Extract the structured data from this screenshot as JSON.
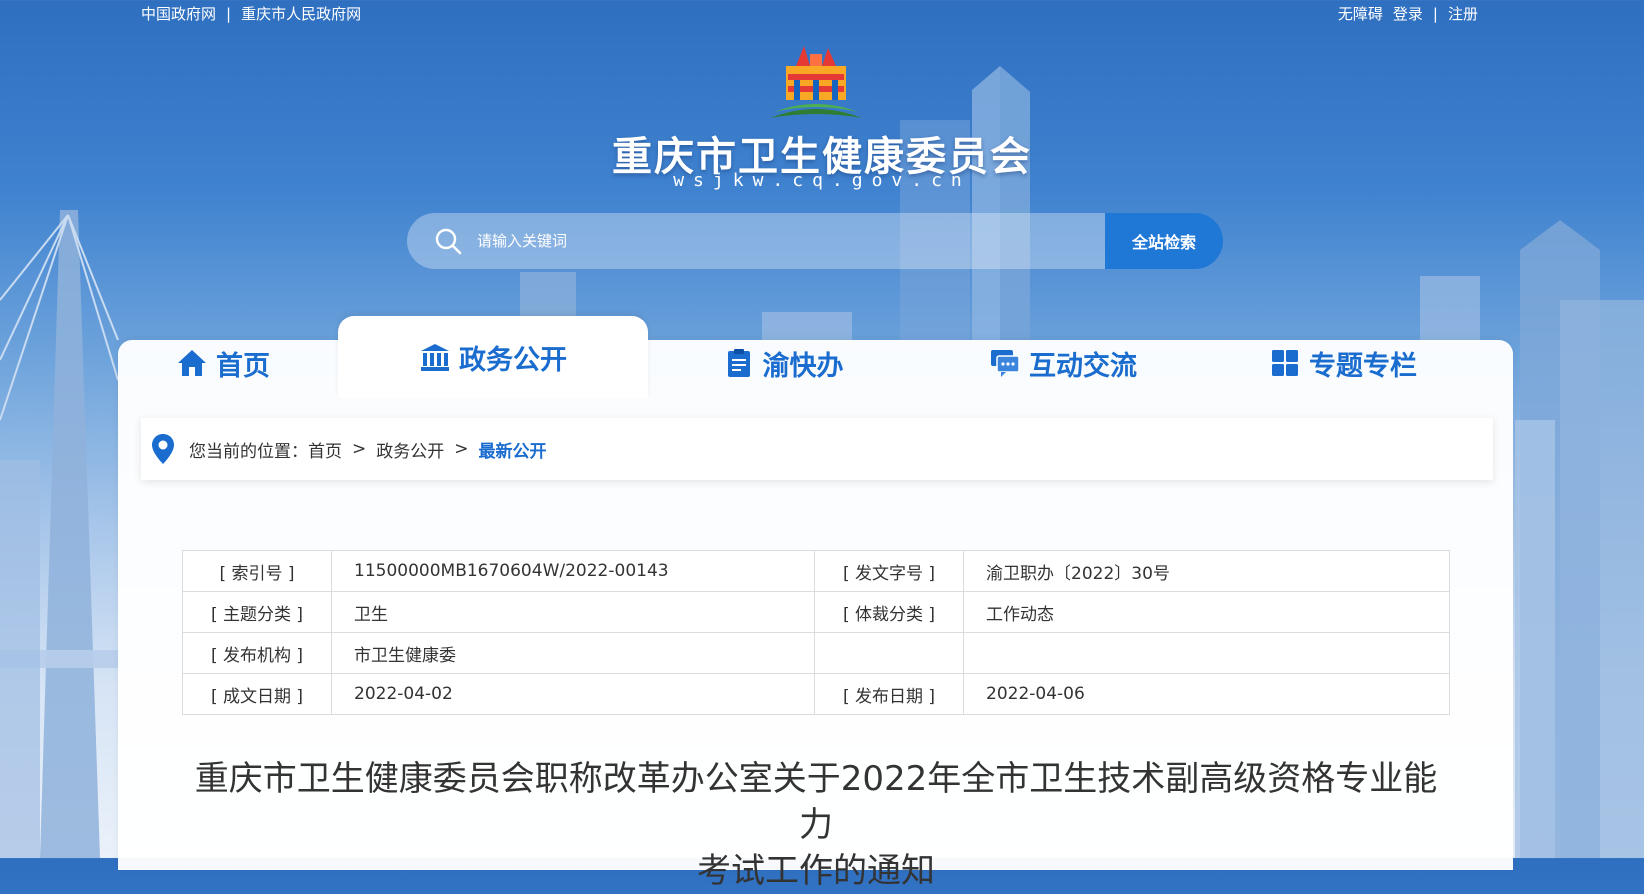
{
  "topbar": {
    "links_left": [
      "中国政府网",
      "重庆市人民政府网"
    ],
    "separator": "|",
    "links_right": [
      "无障碍",
      "登录",
      "注册"
    ]
  },
  "header": {
    "title": "重庆市卫生健康委员会",
    "domain": "wsjkw.cq.gov.cn"
  },
  "search": {
    "placeholder": "请输入关键词",
    "button": "全站检索",
    "icon": "search-icon"
  },
  "nav": {
    "tabs": [
      {
        "label": "首页",
        "icon": "home-icon"
      },
      {
        "label": "政务公开",
        "icon": "government-building-icon",
        "active": true
      },
      {
        "label": "渝快办",
        "icon": "clipboard-icon"
      },
      {
        "label": "互动交流",
        "icon": "chat-icon"
      },
      {
        "label": "专题专栏",
        "icon": "grid-icon"
      }
    ]
  },
  "breadcrumb": {
    "prefix": "您当前的位置：",
    "items": [
      "首页",
      "政务公开",
      "最新公开"
    ],
    "sep": ">"
  },
  "info_table": {
    "rows": [
      {
        "k1": "[ 索引号 ]",
        "v1": "11500000MB1670604W/2022-00143",
        "k2": "[ 发文字号 ]",
        "v2": "渝卫职办〔2022〕30号"
      },
      {
        "k1": "[ 主题分类 ]",
        "v1": "卫生",
        "k2": "[ 体裁分类 ]",
        "v2": "工作动态"
      },
      {
        "k1": "[ 发布机构 ]",
        "v1": "市卫生健康委",
        "k2": "",
        "v2": ""
      },
      {
        "k1": "[ 成文日期 ]",
        "v1": "2022-04-02",
        "k2": "[ 发布日期 ]",
        "v2": "2022-04-06"
      }
    ]
  },
  "article": {
    "title_line1": "重庆市卫生健康委员会职称改革办公室关于2022年全市卫生技术副高级资格专业能力",
    "title_line2": "考试工作的通知"
  },
  "colors": {
    "accent": "#1a6ccf",
    "button": "#1f77d6"
  }
}
